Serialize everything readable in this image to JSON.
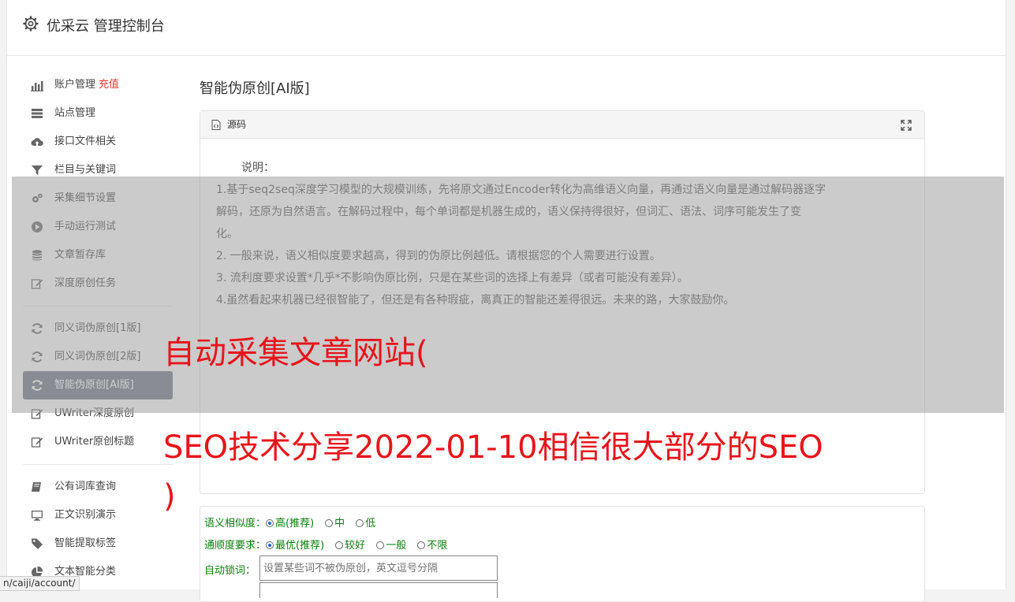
{
  "app": {
    "title": "优采云 管理控制台"
  },
  "sidebar": {
    "groups": [
      [
        {
          "label": "账户管理",
          "badge": "充值",
          "icon": "bar-chart-icon"
        },
        {
          "label": "站点管理",
          "icon": "list-icon"
        },
        {
          "label": "接口文件相关",
          "icon": "cloud-upload-icon"
        },
        {
          "label": "栏目与关键词",
          "icon": "filter-icon"
        },
        {
          "label": "采集细节设置",
          "icon": "gears-icon"
        },
        {
          "label": "手动运行测试",
          "icon": "play-icon"
        },
        {
          "label": "文章暂存库",
          "icon": "database-icon"
        },
        {
          "label": "深度原创任务",
          "icon": "edit-icon"
        }
      ],
      [
        {
          "label": "同义词伪原创[1版]",
          "icon": "refresh-icon"
        },
        {
          "label": "同义词伪原创[2版]",
          "icon": "refresh-icon"
        },
        {
          "label": "智能伪原创[AI版]",
          "icon": "refresh-icon",
          "active": true
        },
        {
          "label": "UWriter深度原创",
          "icon": "edit-icon"
        },
        {
          "label": "UWriter原创标题",
          "icon": "edit-icon"
        }
      ],
      [
        {
          "label": "公有词库查询",
          "icon": "book-icon"
        },
        {
          "label": "正文识别演示",
          "icon": "monitor-icon"
        },
        {
          "label": "智能提取标签",
          "icon": "tag-icon"
        },
        {
          "label": "文本智能分类",
          "icon": "pie-icon"
        }
      ]
    ]
  },
  "main": {
    "heading": "智能伪原创[AI版]",
    "panel": {
      "head_label": "源码",
      "note_title": "说明：",
      "lines": [
        "1.基于seq2seq深度学习模型的大规模训练，先将原文通过Encoder转化为高维语义向量，再通过语义向量是通过解码器逐字",
        "解码，还原为自然语言。在解码过程中，每个单词都是机器生成的，语义保持得很好，但词汇、语法、词序可能发生了变",
        "化。",
        "2. 一般来说，语义相似度要求越高，得到的伪原比例越低。请根据您的个人需要进行设置。",
        "3. 流利度要求设置*几乎*不影响伪原比例，只是在某些词的选择上有差异（或者可能没有差异）。",
        "4.虽然看起来机器已经很智能了，但还是有各种瑕疵，离真正的智能还差得很远。未来的路，大家鼓励你。"
      ]
    },
    "form": {
      "similarity": {
        "label": "语义相似度：",
        "options": [
          "高(推荐)",
          "中",
          "低"
        ],
        "selected": 0
      },
      "fluency": {
        "label": "通顺度要求：",
        "options": [
          "最优(推荐)",
          "较好",
          "一般",
          "不限"
        ],
        "selected": 0
      },
      "lock": {
        "label": "自动锁词：",
        "placeholder": "设置某些词不被伪原创，英文逗号分隔"
      }
    }
  },
  "overlay": {
    "line1": "自动采集文章网站(",
    "line2": "SEO技术分享2022-01-10相信很大部分的SEO",
    "line3": ")"
  },
  "status_url": "n/caiji/account/"
}
